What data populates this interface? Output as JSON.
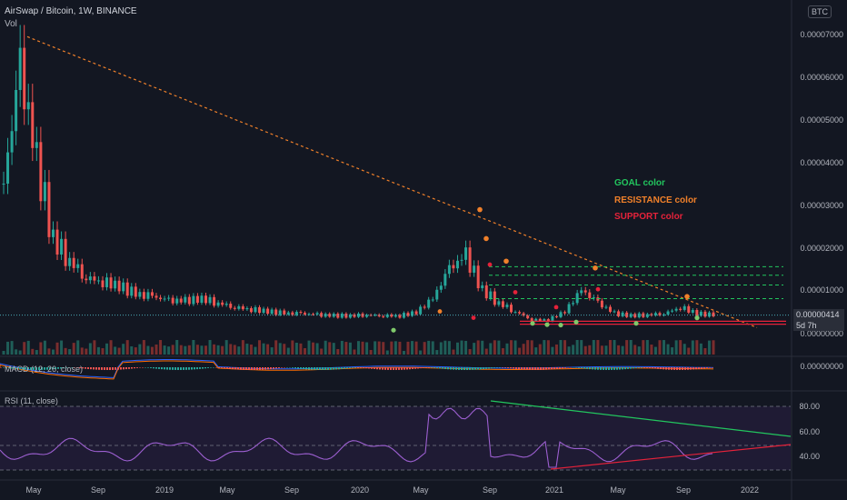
{
  "header": {
    "symbol_title": "AirSwap / Bitcoin, 1W, BINANCE",
    "vol_label": "Vol",
    "currency_badge": "BTC"
  },
  "legend": {
    "goal": "GOAL color",
    "resistance": "RESISTANCE color",
    "support": "SUPPORT color",
    "goal_color": "#22c55e",
    "resistance_color": "#f0802a",
    "support_color": "#e5223a"
  },
  "price_axis": [
    "0.00007000",
    "0.00006000",
    "0.00005000",
    "0.00004000",
    "0.00003000",
    "0.00002000",
    "0.00001000",
    "0.00000000"
  ],
  "current_price": {
    "value": "0.00000414",
    "countdown": "5d 7h"
  },
  "macd": {
    "label": "MACD (12, 26, close)",
    "axis_value": "0.00000000"
  },
  "rsi": {
    "label": "RSI (11, close)",
    "axis": [
      "80.00",
      "60.00",
      "40.00"
    ]
  },
  "time_axis": [
    "May",
    "Sep",
    "2019",
    "May",
    "Sep",
    "2020",
    "May",
    "Sep",
    "2021",
    "May",
    "Sep",
    "2022"
  ],
  "chart_data": {
    "type": "line",
    "title": "AirSwap / Bitcoin, 1W, BINANCE",
    "ylim": [
      0,
      7.3e-05
    ],
    "price_series": {
      "name": "AST/BTC weekly close (approx.)",
      "x": [
        "2018-04",
        "2018-05",
        "2018-06",
        "2018-07",
        "2018-08",
        "2018-09",
        "2018-10",
        "2018-11",
        "2018-12",
        "2019-01",
        "2019-02",
        "2019-03",
        "2019-04",
        "2019-05",
        "2019-06",
        "2019-07",
        "2019-08",
        "2019-09",
        "2019-10",
        "2019-11",
        "2019-12",
        "2020-01",
        "2020-02",
        "2020-03",
        "2020-04",
        "2020-05",
        "2020-06",
        "2020-07",
        "2020-08",
        "2020-09",
        "2020-10",
        "2020-11",
        "2020-12",
        "2021-01",
        "2021-02",
        "2021-03",
        "2021-04",
        "2021-05",
        "2021-06",
        "2021-07",
        "2021-08",
        "2021-09",
        "2021-10",
        "2021-11"
      ],
      "values": [
        3.5e-05,
        6.2e-05,
        4e-05,
        2.2e-05,
        1.7e-05,
        1.3e-05,
        1.2e-05,
        1.1e-05,
        9e-06,
        8.5e-06,
        7.5e-06,
        7.5e-06,
        8e-06,
        7e-06,
        6e-06,
        5.5e-06,
        5e-06,
        4.5e-06,
        4.5e-06,
        4.2e-06,
        4e-06,
        4e-06,
        4.2e-06,
        4e-06,
        4e-06,
        4.8e-06,
        8e-06,
        1.5e-05,
        1.8e-05,
        1e-05,
        7e-06,
        5e-06,
        3e-06,
        3e-06,
        5e-06,
        1e-05,
        7e-06,
        4.5e-06,
        4e-06,
        4.2e-06,
        4.5e-06,
        6e-06,
        4.5e-06,
        4.14e-06
      ]
    },
    "levels": {
      "goal": [
        1.55e-05,
        1.35e-05,
        1.12e-05,
        8e-06
      ],
      "support": [
        2.7e-06,
        2e-06
      ]
    },
    "rsi_levels": [
      80,
      60,
      40
    ]
  }
}
